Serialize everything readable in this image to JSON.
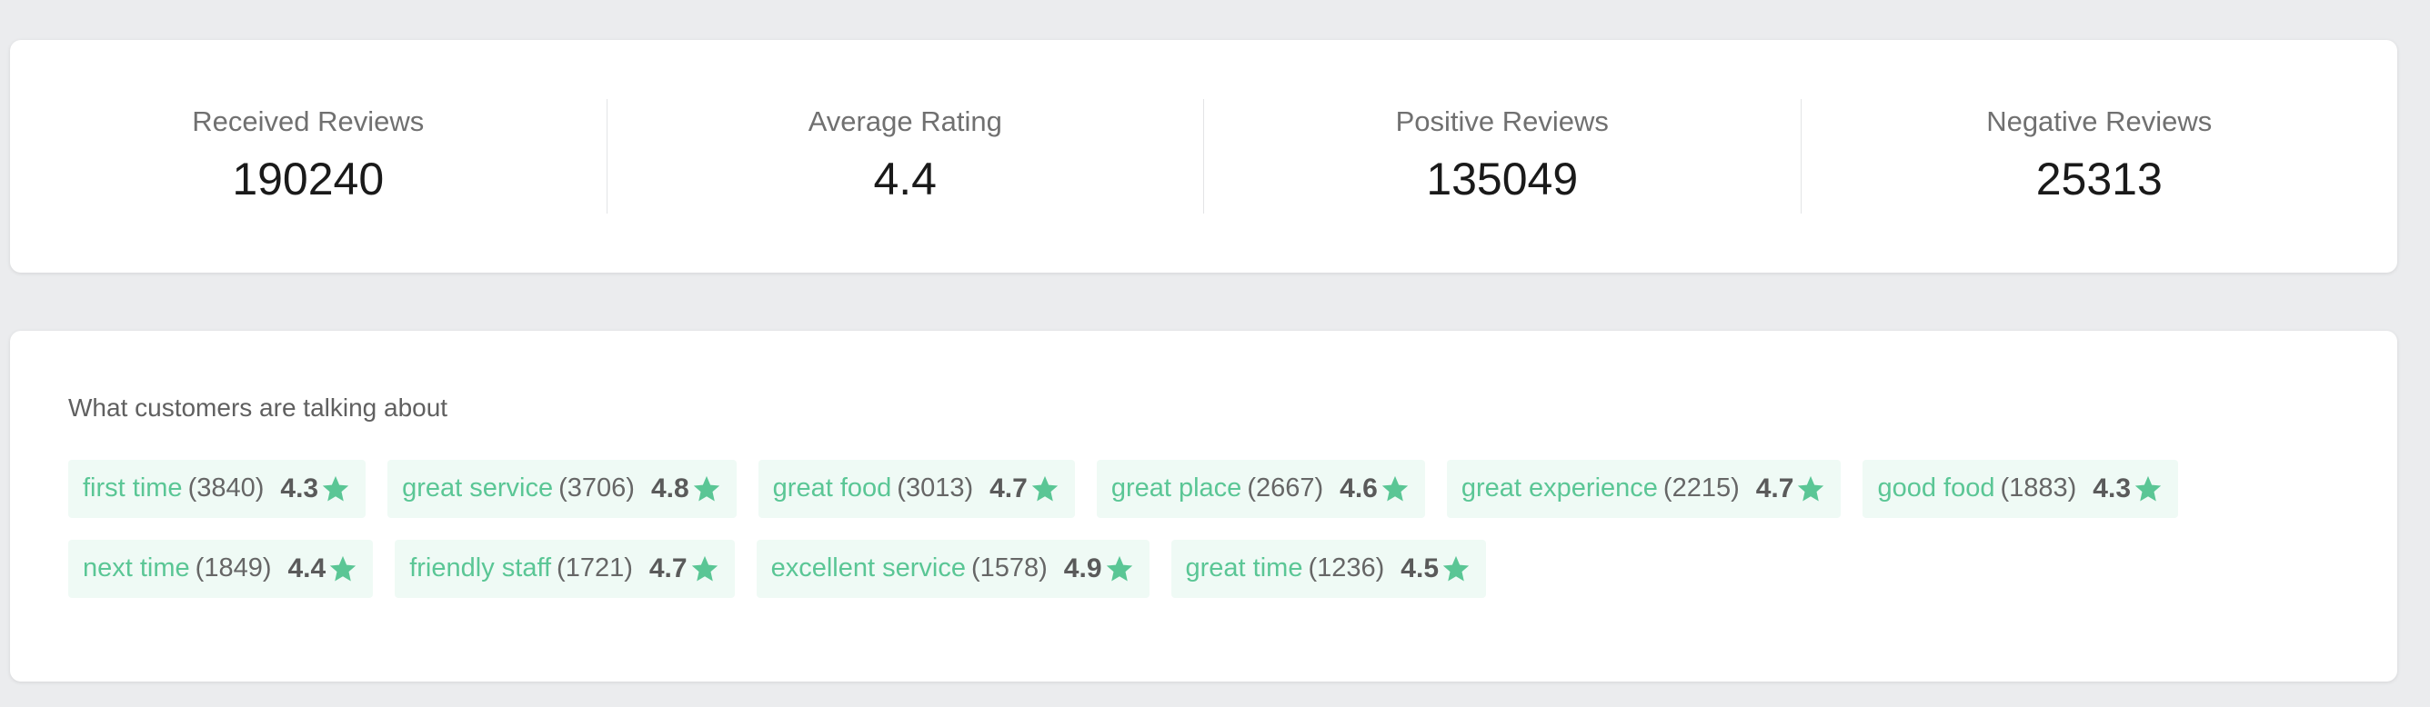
{
  "stats": [
    {
      "label": "Received Reviews",
      "value": "190240"
    },
    {
      "label": "Average Rating",
      "value": "4.4"
    },
    {
      "label": "Positive Reviews",
      "value": "135049"
    },
    {
      "label": "Negative Reviews",
      "value": "25313"
    }
  ],
  "topics": {
    "heading": "What customers are talking about",
    "tags": [
      {
        "name": "first time",
        "count": "(3840)",
        "rating": "4.3",
        "icon": "star-icon"
      },
      {
        "name": "great service",
        "count": "(3706)",
        "rating": "4.8",
        "icon": "star-icon"
      },
      {
        "name": "great food",
        "count": "(3013)",
        "rating": "4.7",
        "icon": "star-icon"
      },
      {
        "name": "great place",
        "count": "(2667)",
        "rating": "4.6",
        "icon": "star-icon"
      },
      {
        "name": "great experience",
        "count": "(2215)",
        "rating": "4.7",
        "icon": "star-icon"
      },
      {
        "name": "good food",
        "count": "(1883)",
        "rating": "4.3",
        "icon": "star-icon"
      },
      {
        "name": "next time",
        "count": "(1849)",
        "rating": "4.4",
        "icon": "star-icon"
      },
      {
        "name": "friendly staff",
        "count": "(1721)",
        "rating": "4.7",
        "icon": "star-icon"
      },
      {
        "name": "excellent service",
        "count": "(1578)",
        "rating": "4.9",
        "icon": "star-icon"
      },
      {
        "name": "great time",
        "count": "(1236)",
        "rating": "4.5",
        "icon": "star-icon"
      }
    ]
  },
  "colors": {
    "accent": "#5ac695",
    "tag_background": "#effaf5",
    "page_background": "#ebecee"
  }
}
